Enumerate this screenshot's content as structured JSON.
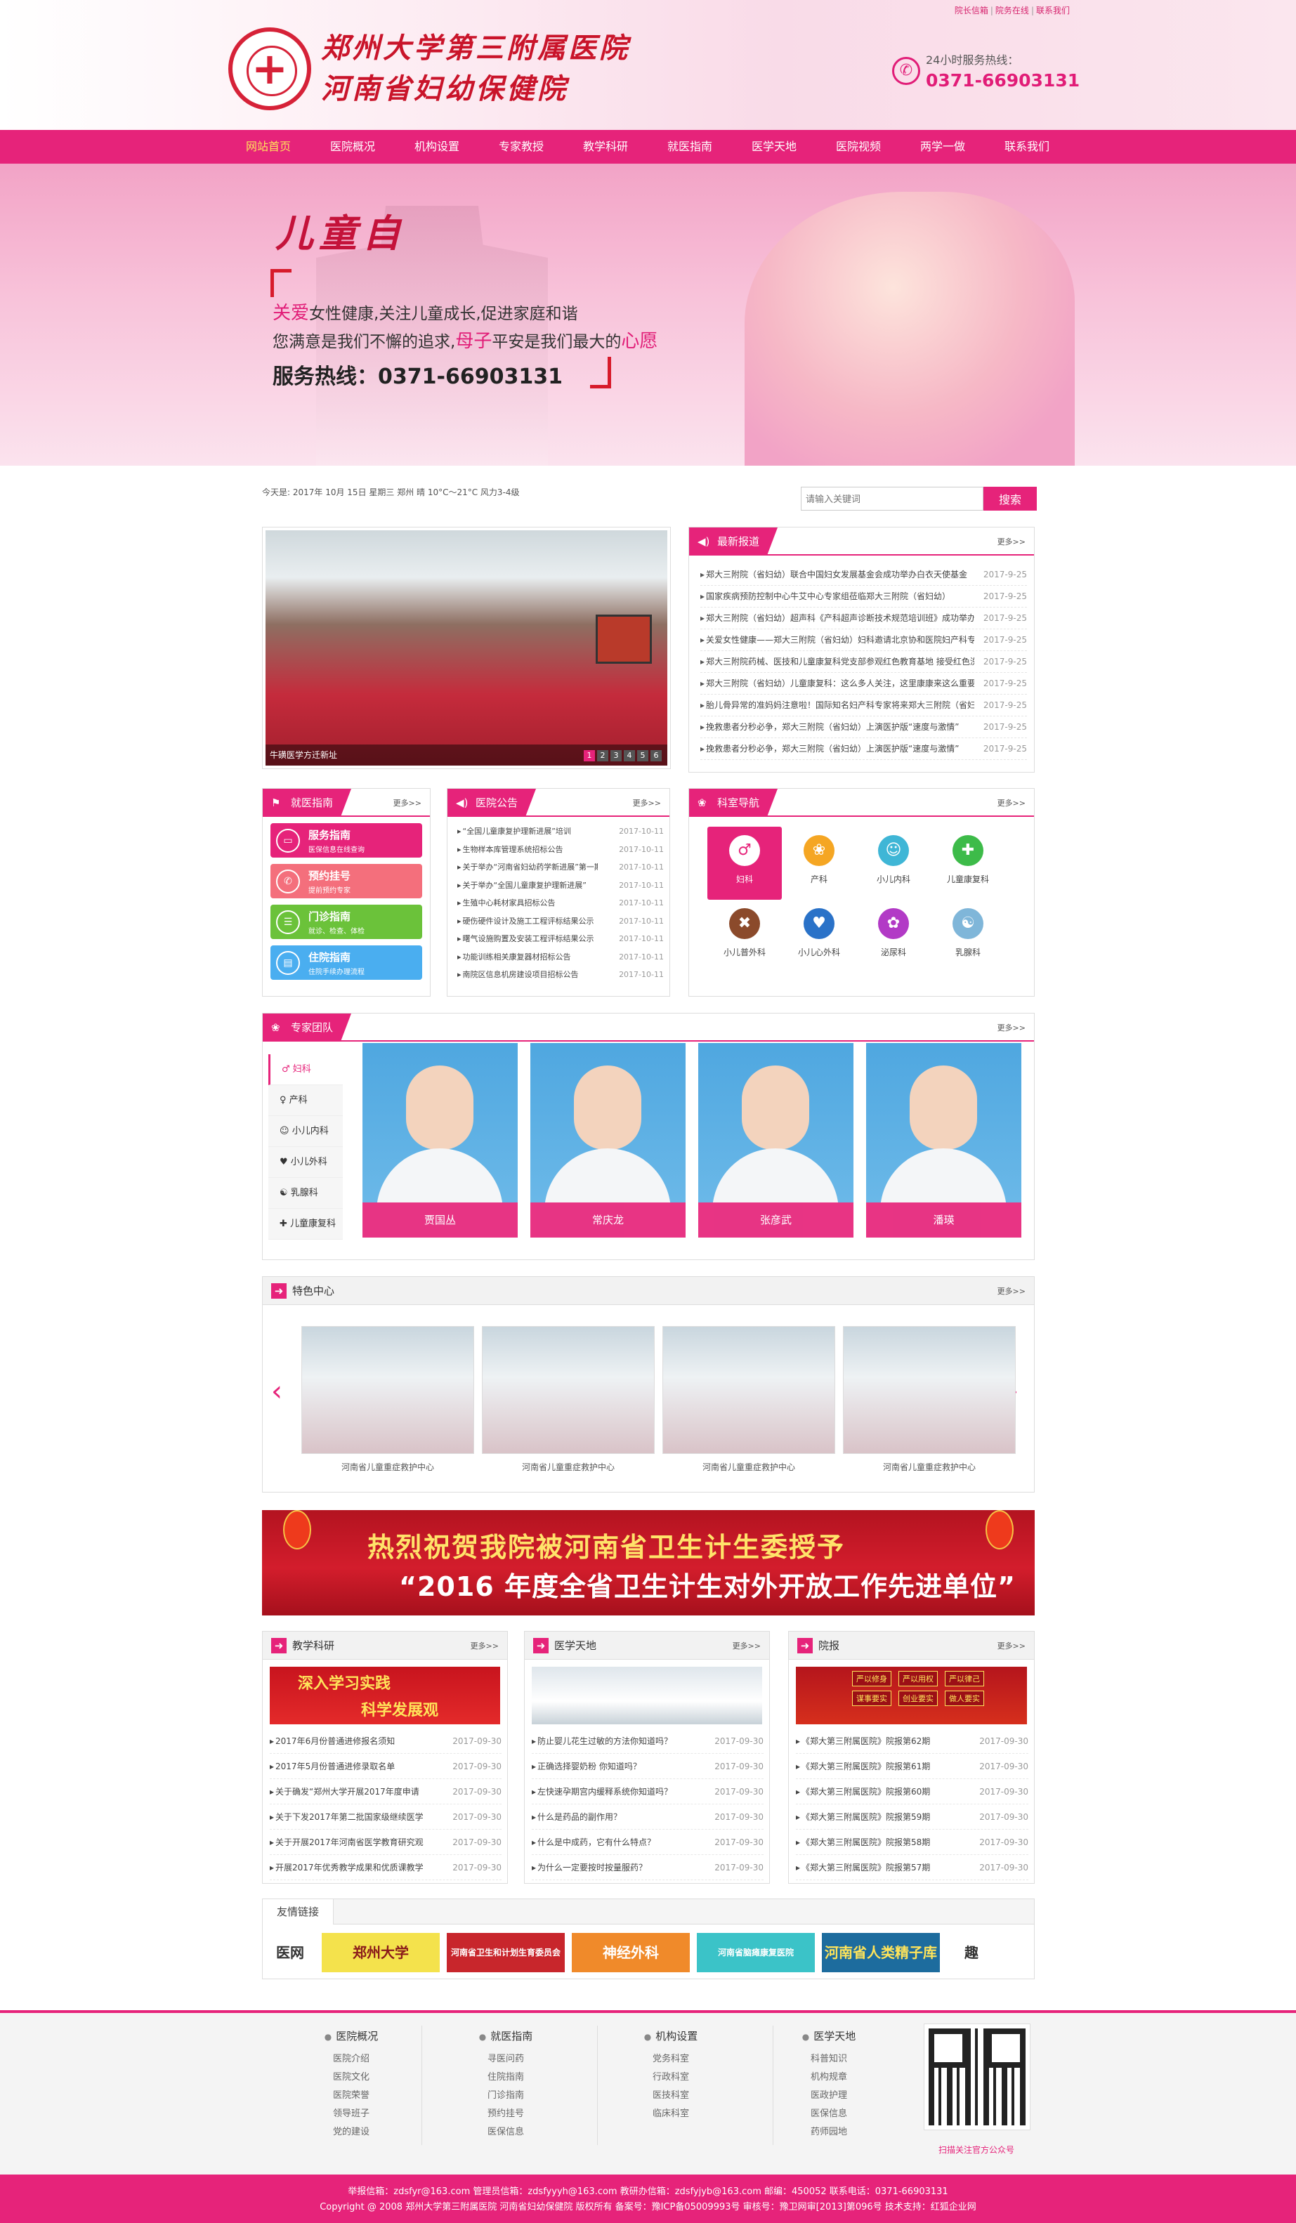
{
  "header": {
    "logo_line1": "郑州大学第三附属医院",
    "logo_line2": "河南省妇幼保健院",
    "top_links": [
      "院长信箱",
      "院务在线",
      "联系我们"
    ],
    "hotline_label": "24小时服务热线：",
    "hotline_number": "0371-66903131"
  },
  "nav": {
    "items": [
      "网站首页",
      "医院概况",
      "机构设置",
      "专家教授",
      "教学科研",
      "就医指南",
      "医学天地",
      "医院视频",
      "两学一做",
      "联系我们"
    ],
    "active_index": 0
  },
  "banner": {
    "title": "儿童自",
    "slogan1_hl": "关爱",
    "slogan1_rest": "女性健康,关注儿童成长,促进家庭和谐",
    "slogan2_a": "您满意是我们不懈的追求,",
    "slogan2_hl1": "母子",
    "slogan2_b": "平安是我们最大的",
    "slogan2_hl2": "心愿",
    "hotline": "服务热线：0371-66903131"
  },
  "weather": "今天是: 2017年 10月 15日 星期三  郑州  晴  10°C～21°C  风力3-4级",
  "search": {
    "placeholder": "请输入关键词",
    "button": "搜索"
  },
  "slider": {
    "caption": "牛磺医学方迁新址",
    "dots": [
      "1",
      "2",
      "3",
      "4",
      "5",
      "6"
    ],
    "active": 1
  },
  "latest_news": {
    "title": "最新报道",
    "more": "更多>>",
    "items": [
      {
        "t": "郑大三附院（省妇幼）联合中国妇女发展基金会成功举办白衣天使基金",
        "d": "2017-9-25"
      },
      {
        "t": "国家疾病预防控制中心牛艾中心专家组莅临郑大三附院（省妇幼）",
        "d": "2017-9-25"
      },
      {
        "t": "郑大三附院（省妇幼）超声科《产科超声诊断技术规范培训班》成功举办",
        "d": "2017-9-25"
      },
      {
        "t": "关爱女性健康——郑大三附院（省妇幼）妇科邀请北京协和医院妇产科专家",
        "d": "2017-9-25"
      },
      {
        "t": "郑大三附院药械、医技和儿童康复科党支部参观红色教育基地 接受红色洗礼",
        "d": "2017-9-25"
      },
      {
        "t": "郑大三附院（省妇幼）儿童康复科：这么多人关注，这里康康来这么重要！",
        "d": "2017-9-25"
      },
      {
        "t": "胎儿骨异常的准妈妈注意啦！国际知名妇产科专家将来郑大三附院（省妇幼）",
        "d": "2017-9-25"
      },
      {
        "t": "挽救患者分秒必争，郑大三附院（省妇幼）上演医护版“速度与激情”",
        "d": "2017-9-25"
      },
      {
        "t": "挽救患者分秒必争，郑大三附院（省妇幼）上演医护版“速度与激情”",
        "d": "2017-9-25"
      }
    ]
  },
  "guide": {
    "title": "就医指南",
    "more": "更多>>",
    "items": [
      {
        "label": "服务指南",
        "sub": "医保信息在线查询",
        "color": "#e6237a",
        "icon": "card-icon"
      },
      {
        "label": "预约挂号",
        "sub": "提前预约专家",
        "color": "#f46f7c",
        "icon": "phone-icon"
      },
      {
        "label": "门诊指南",
        "sub": "就诊、检查、体检",
        "color": "#6bc23a",
        "icon": "clipboard-icon"
      },
      {
        "label": "住院指南",
        "sub": "住院手续办理流程",
        "color": "#4aaef0",
        "icon": "document-icon"
      }
    ]
  },
  "notice": {
    "title": "医院公告",
    "more": "更多>>",
    "items": [
      {
        "t": "“全国儿童康复护理新进展”培训",
        "d": "2017-10-11"
      },
      {
        "t": "生物样本库管理系统招标公告",
        "d": "2017-10-11"
      },
      {
        "t": "关于举办“河南省妇幼药学新进展”第一期",
        "d": "2017-10-11"
      },
      {
        "t": "关于举办“全国儿童康复护理新进展”",
        "d": "2017-10-11"
      },
      {
        "t": "生殖中心耗材家具招标公告",
        "d": "2017-10-11"
      },
      {
        "t": "硬伤硬件设计及施工工程评标结果公示",
        "d": "2017-10-11"
      },
      {
        "t": "曙气设施购置及安装工程评标结果公示",
        "d": "2017-10-11"
      },
      {
        "t": "功能训练相关康复器材招标公告",
        "d": "2017-10-11"
      },
      {
        "t": "南院区信息机房建设项目招标公告",
        "d": "2017-10-11"
      }
    ]
  },
  "departments": {
    "title": "科室导航",
    "more": "更多>>",
    "items": [
      {
        "label": "妇科",
        "icon": "female-symbol-icon",
        "color": "#e6237a",
        "glyph": "♂"
      },
      {
        "label": "产科",
        "icon": "pregnancy-icon",
        "color": "#f5a623",
        "glyph": "❀"
      },
      {
        "label": "小儿内科",
        "icon": "child-icon",
        "color": "#3fb6d6",
        "glyph": "☺"
      },
      {
        "label": "儿童康复科",
        "icon": "person-icon",
        "color": "#3dbb49",
        "glyph": "✚"
      },
      {
        "label": "小儿普外科",
        "icon": "cross-icon",
        "color": "#8b4a2b",
        "glyph": "✖"
      },
      {
        "label": "小儿心外科",
        "icon": "heart-icon",
        "color": "#2a72c8",
        "glyph": "♥"
      },
      {
        "label": "泌尿科",
        "icon": "flower-icon",
        "color": "#b23ac6",
        "glyph": "✿"
      },
      {
        "label": "乳腺科",
        "icon": "bra-icon",
        "color": "#7fb6d9",
        "glyph": "☯"
      }
    ],
    "selected": 0
  },
  "experts": {
    "title": "专家团队",
    "more": "更多>>",
    "tabs": [
      "妇科",
      "产科",
      "小儿内科",
      "小儿外科",
      "乳腺科",
      "儿童康复科"
    ],
    "active_tab": 0,
    "people": [
      "贾国丛",
      "常庆龙",
      "张彦武",
      "潘瑛"
    ]
  },
  "featured": {
    "title": "特色中心",
    "more": "更多>>",
    "items": [
      "河南省儿童重症救护中心",
      "河南省儿童重症救护中心",
      "河南省儿童重症救护中心",
      "河南省儿童重症救护中心"
    ]
  },
  "award": {
    "line1": "热烈祝贺我院被河南省卫生计生委授予",
    "line2": "“2016 年度全省卫生计生对外开放工作先进单位”"
  },
  "teaching": {
    "title": "教学科研",
    "more": "更多>>",
    "banner_line1": "深入学习实践",
    "banner_line2": "科学发展观",
    "items": [
      {
        "t": "2017年6月份普通进修报名须知",
        "d": "2017-09-30"
      },
      {
        "t": "2017年5月份普通进修录取名单",
        "d": "2017-09-30"
      },
      {
        "t": "关于确发“郑州大学开展2017年度申请",
        "d": "2017-09-30"
      },
      {
        "t": "关于下发2017年第二批国家级继续医学",
        "d": "2017-09-30"
      },
      {
        "t": "关于开展2017年河南省医学教育研究观",
        "d": "2017-09-30"
      },
      {
        "t": "开展2017年优秀教学成果和优质课教学",
        "d": "2017-09-30"
      }
    ]
  },
  "medical": {
    "title": "医学天地",
    "more": "更多>>",
    "items": [
      {
        "t": "防止婴儿花生过敏的方法你知道吗？",
        "d": "2017-09-30"
      },
      {
        "t": "正确选择婴奶粉 你知道吗？",
        "d": "2017-09-30"
      },
      {
        "t": "左快速孕期宫内缓释系统你知道吗？",
        "d": "2017-09-30"
      },
      {
        "t": "什么是药品的副作用？",
        "d": "2017-09-30"
      },
      {
        "t": "什么是中成药，它有什么特点？",
        "d": "2017-09-30"
      },
      {
        "t": "为什么一定要按时按量服药？",
        "d": "2017-09-30"
      }
    ]
  },
  "journal": {
    "title": "院报",
    "more": "更多>>",
    "banner_tags": [
      "严以修身",
      "严以用权",
      "严以律己",
      "谋事要实",
      "创业要实",
      "做人要实"
    ],
    "items": [
      {
        "t": "《郑大第三附属医院》院报第62期",
        "d": "2017-09-30"
      },
      {
        "t": "《郑大第三附属医院》院报第61期",
        "d": "2017-09-30"
      },
      {
        "t": "《郑大第三附属医院》院报第60期",
        "d": "2017-09-30"
      },
      {
        "t": "《郑大第三附属医院》院报第59期",
        "d": "2017-09-30"
      },
      {
        "t": "《郑大第三附属医院》院报第58期",
        "d": "2017-09-30"
      },
      {
        "t": "《郑大第三附属医院》院报第57期",
        "d": "2017-09-30"
      }
    ]
  },
  "friend_links": {
    "title": "友情链接",
    "items": [
      {
        "label": "医网",
        "bg": "#ffffff",
        "fg": "#333333"
      },
      {
        "label": "郑州大学",
        "bg": "#f4e24c",
        "fg": "#8a1a1a"
      },
      {
        "label": "河南省卫生和计划生育委员会",
        "bg": "#c8262c",
        "fg": "#ffffff"
      },
      {
        "label": "神经外科",
        "bg": "#f08a2a",
        "fg": "#ffffff"
      },
      {
        "label": "河南省脑瘫康复医院",
        "bg": "#3bc3c8",
        "fg": "#ffffff"
      },
      {
        "label": "河南省人类精子库",
        "bg": "#1d6c9e",
        "fg": "#ffe45a"
      },
      {
        "label": "趣",
        "bg": "#ffffff",
        "fg": "#333333"
      }
    ]
  },
  "footer": {
    "columns": [
      {
        "title": "医院概况",
        "items": [
          "医院介绍",
          "医院文化",
          "医院荣誉",
          "领导班子",
          "党的建设"
        ]
      },
      {
        "title": "就医指南",
        "items": [
          "寻医问药",
          "住院指南",
          "门诊指南",
          "预约挂号",
          "医保信息"
        ]
      },
      {
        "title": "机构设置",
        "items": [
          "党务科室",
          "行政科室",
          "医技科室",
          "临床科室"
        ]
      },
      {
        "title": "医学天地",
        "items": [
          "科普知识",
          "机构规章",
          "医政护理",
          "医保信息",
          "药师园地"
        ]
      }
    ],
    "qr_caption": "扫描关注官方公众号",
    "line1": "举报信箱：zdsfyr@163.com  管理员信箱：zdsfyyyh@163.com  教研办信箱：zdsfyjyb@163.com  邮编：450052  联系电话：0371-66903131",
    "line2": "Copyright @ 2008  郑州大学第三附属医院  河南省妇幼保健院  版权所有  备案号：豫ICP备05009993号  审核号：豫卫网审[2013]第096号  技术支持：红狐企业网"
  }
}
